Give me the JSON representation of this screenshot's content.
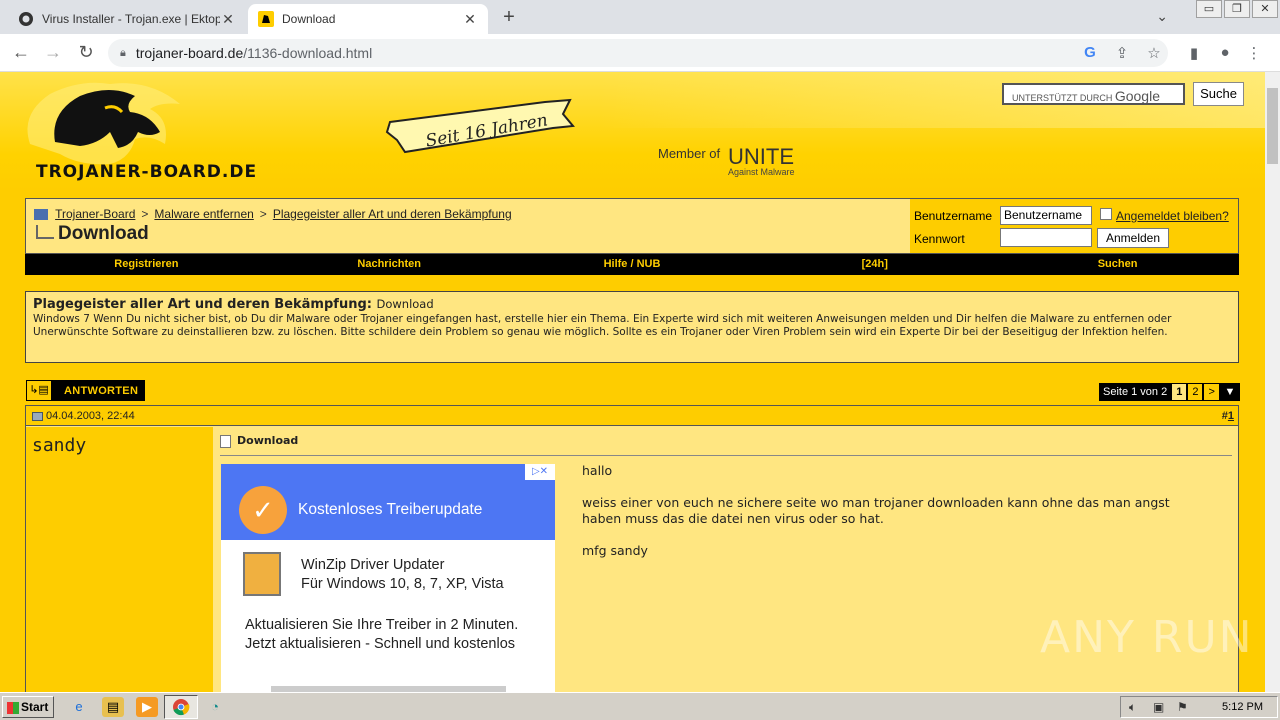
{
  "browser": {
    "tabs": [
      {
        "title": "Virus Installer - Trojan.exe | Ektoplaz",
        "active": false
      },
      {
        "title": "Download",
        "active": true
      }
    ],
    "url_host": "trojaner-board.de",
    "url_path": "/1136-download.html"
  },
  "site": {
    "logo_text": "TROJANER-BOARD.DE",
    "banner_text": "Seit 16 Jahren",
    "member_of": "Member of",
    "unite": "UNITE",
    "unite_sub": "Against Malware",
    "search_placeholder": "UNTERSTÜTZT DURCH",
    "search_brand": "Google",
    "search_button": "Suche"
  },
  "breadcrumb": {
    "items": [
      "Trojaner-Board",
      "Malware entfernen",
      "Plagegeister aller Art und deren Bekämpfung"
    ],
    "separator": ">",
    "page_title": "Download"
  },
  "login": {
    "username_label": "Benutzername",
    "username_value": "Benutzername",
    "password_label": "Kennwort",
    "remember_label": "Angemeldet bleiben?",
    "login_button": "Anmelden"
  },
  "nav": [
    "Registrieren",
    "Nachrichten",
    "Hilfe / NUB",
    "[24h]",
    "Suchen"
  ],
  "forum": {
    "name": "Plagegeister aller Art und deren Bekämpfung:",
    "thread": "Download",
    "description": "Windows 7 Wenn Du nicht sicher bist, ob Du dir Malware oder Trojaner eingefangen hast, erstelle hier ein Thema. Ein Experte wird sich mit weiteren Anweisungen melden und Dir helfen die Malware zu entfernen oder Unerwünschte Software zu deinstallieren bzw. zu löschen. Bitte schildere dein Problem so genau wie möglich. Sollte es ein Trojaner oder Viren Problem sein wird ein Experte Dir bei der Beseitigug der Infektion helfen."
  },
  "reply_label": "ANTWORTEN",
  "pager": {
    "label": "Seite 1 von 2",
    "pages": [
      "1",
      "2",
      ">"
    ],
    "current": "1"
  },
  "post": {
    "date": "04.04.2003, 22:44",
    "number_prefix": "#",
    "number": "1",
    "username": "sandy",
    "title": "Download",
    "text": "hallo\n\nweiss einer von euch ne sichere seite wo man trojaner downloaden kann ohne das man angst\nhaben muss das die datei nen virus oder so hat.\n\nmfg sandy"
  },
  "ad": {
    "headline": "Kostenloses Treiberupdate",
    "product_line1": "WinZip Driver Updater",
    "product_line2": "Für Windows 10, 8, 7, XP, Vista",
    "line1": "Aktualisieren Sie Ihre Treiber in 2 Minuten.",
    "line2": "Jetzt aktualisieren - Schnell und kostenlos"
  },
  "watermark": "ANY RUN",
  "taskbar": {
    "start_label": "Start",
    "clock": "5:12 PM"
  }
}
